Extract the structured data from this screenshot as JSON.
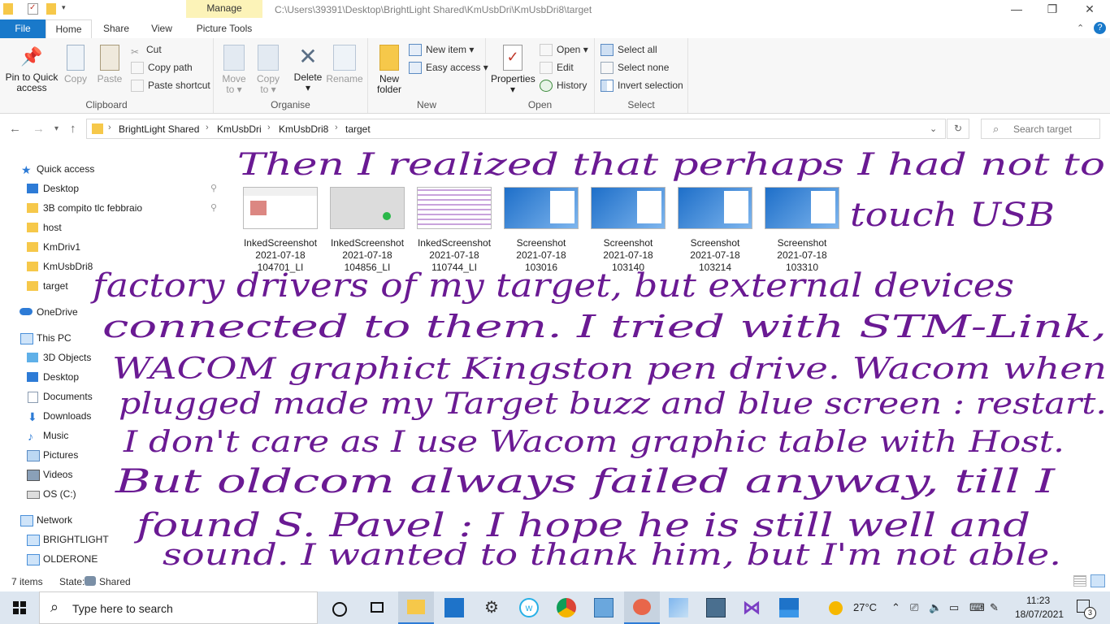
{
  "window": {
    "path_title": "C:\\Users\\39391\\Desktop\\BrightLight Shared\\KmUsbDri\\KmUsbDri8\\target",
    "manage_label": "Manage",
    "minimize": "—",
    "restore": "❐",
    "close": "✕"
  },
  "ribbon_tabs": {
    "file": "File",
    "home": "Home",
    "share": "Share",
    "view": "View",
    "picture_tools": "Picture Tools"
  },
  "ribbon": {
    "clipboard": {
      "label": "Clipboard",
      "pin_line1": "Pin to Quick",
      "pin_line2": "access",
      "copy": "Copy",
      "paste": "Paste",
      "cut": "Cut",
      "copy_path": "Copy path",
      "paste_shortcut": "Paste shortcut"
    },
    "organise": {
      "label": "Organise",
      "move_to_1": "Move",
      "move_to_2": "to",
      "copy_to_1": "Copy",
      "copy_to_2": "to",
      "delete": "Delete",
      "rename": "Rename"
    },
    "new": {
      "label": "New",
      "new_folder_1": "New",
      "new_folder_2": "folder",
      "new_item": "New item",
      "easy_access": "Easy access"
    },
    "open": {
      "label": "Open",
      "properties": "Properties",
      "open": "Open",
      "edit": "Edit",
      "history": "History"
    },
    "select": {
      "label": "Select",
      "select_all": "Select all",
      "select_none": "Select none",
      "invert_selection": "Invert selection"
    }
  },
  "address": {
    "crumbs": [
      "BrightLight Shared",
      "KmUsbDri",
      "KmUsbDri8",
      "target"
    ],
    "search_placeholder": "Search target"
  },
  "nav": {
    "quick_access": "Quick access",
    "quick_items": [
      "Desktop",
      "3B compito tlc febbraio",
      "host",
      "KmDriv1",
      "KmUsbDri8",
      "target"
    ],
    "onedrive": "OneDrive",
    "this_pc": "This PC",
    "pc_items": [
      "3D Objects",
      "Desktop",
      "Documents",
      "Downloads",
      "Music",
      "Pictures",
      "Videos",
      "OS (C:)"
    ],
    "network": "Network",
    "network_items": [
      "BRIGHTLIGHT",
      "OLDERONE"
    ]
  },
  "files": [
    {
      "line1": "InkedScreenshot",
      "line2": "2021-07-18",
      "line3": "104701_LI"
    },
    {
      "line1": "InkedScreenshot",
      "line2": "2021-07-18",
      "line3": "104856_LI"
    },
    {
      "line1": "InkedScreenshot",
      "line2": "2021-07-18",
      "line3": "110744_LI"
    },
    {
      "line1": "Screenshot",
      "line2": "2021-07-18",
      "line3": "103016"
    },
    {
      "line1": "Screenshot",
      "line2": "2021-07-18",
      "line3": "103140"
    },
    {
      "line1": "Screenshot",
      "line2": "2021-07-18",
      "line3": "103214"
    },
    {
      "line1": "Screenshot",
      "line2": "2021-07-18",
      "line3": "103310"
    }
  ],
  "handwriting": [
    "Then I realized that perhaps I had not to",
    "touch USB",
    "factory drivers of my target, but external devices",
    "connected to them. I tried with STM-Link,",
    "WACOM graphict Kingston pen drive. Wacom when",
    "plugged made my Target buzz and blue screen : restart.",
    "I don't care as I use Wacom graphic table with Host.",
    "But oldcom always failed anyway, till I",
    "found S. Pavel : I hope he is still well and",
    "sound. I wanted to thank him, but I'm not able."
  ],
  "status": {
    "items": "7 items",
    "state_label": "State:",
    "state_value": "Shared"
  },
  "taskbar": {
    "search_placeholder": "Type here to search",
    "temperature": "27°C",
    "time": "11:23",
    "date": "18/07/2021",
    "notification_count": "3"
  },
  "colors": {
    "accent": "#1979ca",
    "handwriting": "#6a1a93",
    "manage_tab": "#fcf3b8",
    "taskbar": "#dde6f0"
  }
}
